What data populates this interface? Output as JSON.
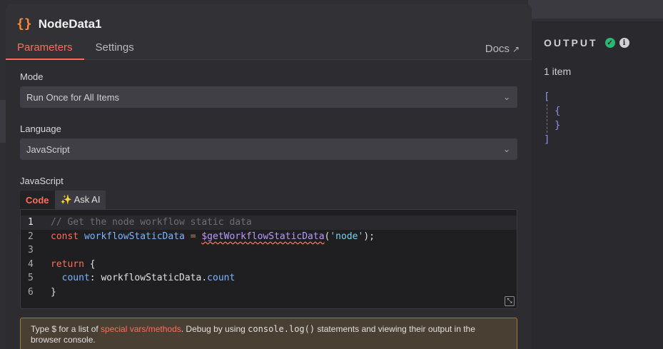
{
  "node": {
    "title": "NodeData1",
    "icon": "braces-icon",
    "tabs": [
      "Parameters",
      "Settings"
    ],
    "docs_label": "Docs"
  },
  "mode": {
    "label": "Mode",
    "value": "Run Once for All Items"
  },
  "language": {
    "label": "Language",
    "value": "JavaScript"
  },
  "editor": {
    "label": "JavaScript",
    "tab_code": "Code",
    "tab_ask": "✨ Ask AI",
    "lines": [
      {
        "n": "1",
        "text": "// Get the node workflow static data"
      },
      {
        "n": "2",
        "text": "const workflowStaticData = $getWorkflowStaticData('node');"
      },
      {
        "n": "3",
        "text": ""
      },
      {
        "n": "4",
        "text": "return {"
      },
      {
        "n": "5",
        "text": "  count: workflowStaticData.count"
      },
      {
        "n": "6",
        "text": "}"
      }
    ]
  },
  "hint": {
    "part1": "Type $ for a list of ",
    "link": "special vars/methods",
    "part2": ". Debug by using ",
    "code": "console.log()",
    "part3": " statements and viewing their output in the browser console."
  },
  "output": {
    "title": "OUTPUT",
    "count": "1 item",
    "json_open": "[",
    "obj_open": "{",
    "obj_close": "}",
    "json_close": "]"
  },
  "colors": {
    "accent": "#ff6d5a",
    "success": "#2bb673",
    "node_icon": "#ff8a3d"
  }
}
